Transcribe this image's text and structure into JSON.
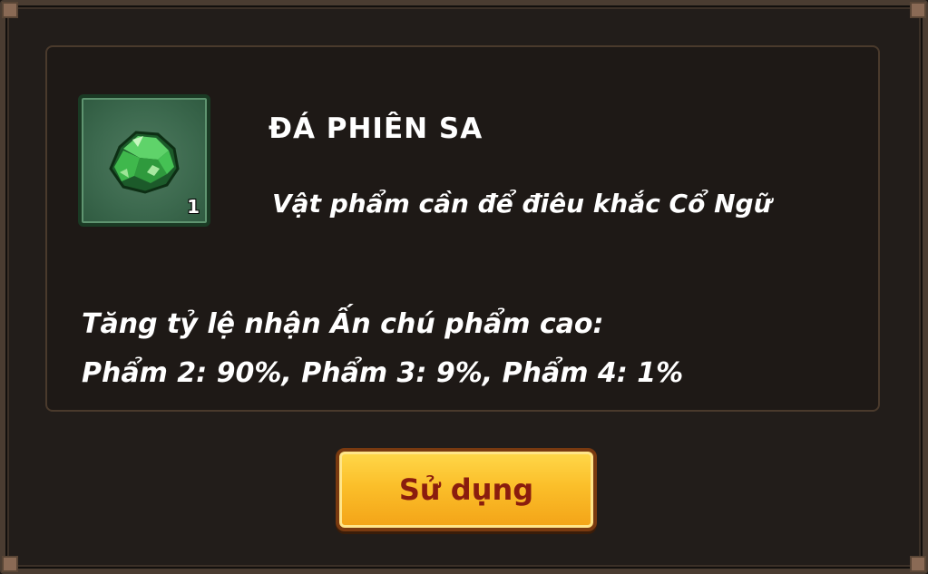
{
  "item": {
    "name": "ĐÁ PHIÊN SA",
    "description": "Vật phẩm cần để điêu khắc Cổ Ngữ",
    "quantity": "1",
    "icon": "green-stone-icon"
  },
  "effect": {
    "line1": "Tăng tỷ lệ nhận Ấn chú phẩm cao:",
    "line2": "Phẩm 2: 90%, Phẩm 3: 9%, Phẩm 4: 1%"
  },
  "actions": {
    "use_label": "Sử dụng"
  },
  "colors": {
    "panel_bg": "#1e1916",
    "slot_green": "#3d6a4f",
    "button_yellow": "#fbbf2a",
    "button_text": "#8a1d0e",
    "text": "#ffffff"
  }
}
